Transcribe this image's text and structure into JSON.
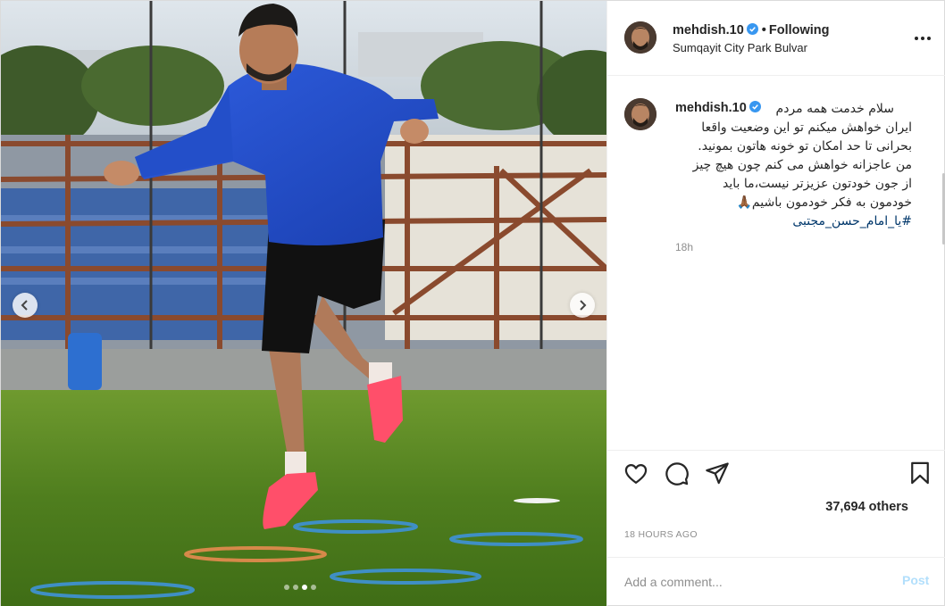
{
  "post": {
    "username": "mehdish.10",
    "follow_status": "Following",
    "separator": "•",
    "location": "Sumqayit City Park Bulvar"
  },
  "caption": {
    "username": "mehdish.10",
    "lines": [
      "سلام خدمت همه مردم",
      "ایران خواهش میکنم تو این وضعیت واقعا",
      "بحرانی تا حد امکان تو خونه هاتون بمونید.",
      "من عاجزانه خواهش می کنم چون هیچ چیز",
      "از جون خودتون عزیزتر نیست،ما باید",
      "خودمون به فکر خودمون باشیم🙏🏾"
    ],
    "hashtag": "#یا_امام_حسن_مجتبی",
    "age": "18h"
  },
  "actions": {
    "likes": "37,694 others",
    "time_ago": "18 HOURS AGO"
  },
  "comment_box": {
    "placeholder": "Add a comment...",
    "post_label": "Post"
  },
  "carousel": {
    "slide_count": 4,
    "active_index": 2
  },
  "colors": {
    "accent": "#0095f6",
    "post_disabled": "#b2dffc",
    "hashtag": "#00376b",
    "muted": "#8e8e8e"
  },
  "icons": [
    "verified-badge-icon",
    "more-options-icon",
    "heart-icon",
    "comment-icon",
    "share-icon",
    "bookmark-icon",
    "chevron-left-icon",
    "chevron-right-icon"
  ]
}
